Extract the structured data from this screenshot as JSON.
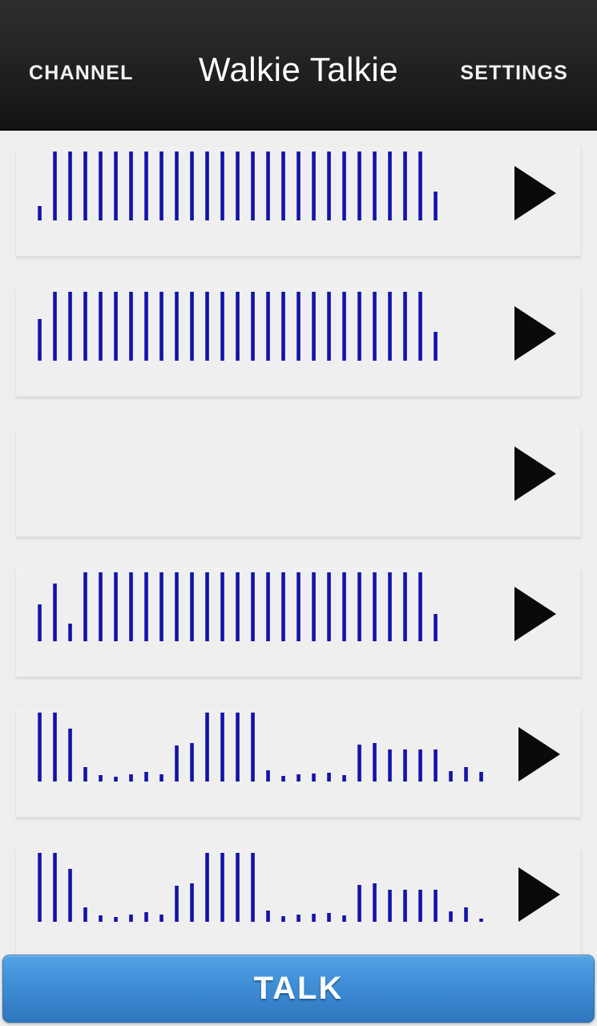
{
  "header": {
    "left_button": "CHANNEL",
    "title": "Walkie Talkie",
    "right_button": "SETTINGS"
  },
  "footer": {
    "talk_label": "TALK"
  },
  "colors": {
    "header_bg": "#1c1c1c",
    "waveform_bar": "#1414a6",
    "card_bg": "#efefef",
    "page_bg": "#eeeeee",
    "talk_button": "#4595dc",
    "play_icon": "#0a0a0a"
  },
  "messages": [
    {
      "id": 1,
      "play_label": "play-message-1",
      "waveform": [
        18,
        86,
        86,
        86,
        86,
        86,
        86,
        86,
        86,
        86,
        86,
        86,
        86,
        86,
        86,
        86,
        86,
        86,
        86,
        86,
        86,
        86,
        86,
        86,
        86,
        86,
        36
      ]
    },
    {
      "id": 2,
      "play_label": "play-message-2",
      "waveform": [
        52,
        86,
        86,
        86,
        86,
        86,
        86,
        86,
        86,
        86,
        86,
        86,
        86,
        86,
        86,
        86,
        86,
        86,
        86,
        86,
        86,
        86,
        86,
        86,
        86,
        86,
        36
      ]
    },
    {
      "id": 3,
      "play_label": "play-message-3",
      "waveform": []
    },
    {
      "id": 4,
      "play_label": "play-message-4",
      "waveform": [
        46,
        72,
        22,
        86,
        86,
        86,
        86,
        86,
        86,
        86,
        86,
        86,
        86,
        86,
        86,
        86,
        86,
        86,
        86,
        86,
        86,
        86,
        86,
        86,
        86,
        86,
        34
      ]
    },
    {
      "id": 5,
      "play_label": "play-message-5",
      "waveform": [
        86,
        86,
        66,
        18,
        8,
        6,
        9,
        12,
        9,
        45,
        48,
        86,
        86,
        86,
        86,
        14,
        7,
        9,
        10,
        11,
        8,
        46,
        48,
        40,
        40,
        40,
        40,
        13,
        18,
        12
      ]
    },
    {
      "id": 6,
      "play_label": "play-message-6",
      "waveform": [
        86,
        86,
        66,
        18,
        8,
        6,
        9,
        12,
        9,
        45,
        48,
        86,
        86,
        86,
        86,
        14,
        7,
        9,
        10,
        11,
        8,
        46,
        48,
        40,
        40,
        40,
        40,
        13,
        18,
        4
      ]
    }
  ]
}
